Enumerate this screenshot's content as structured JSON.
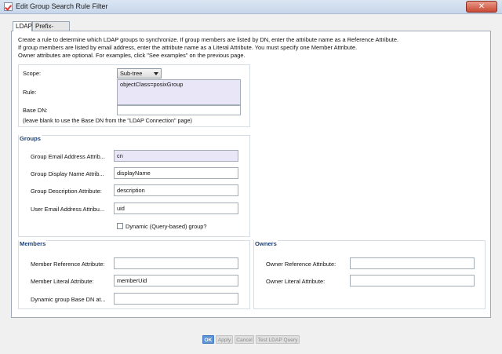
{
  "window": {
    "title": "Edit Group Search Rule Filter",
    "close_glyph": "✕"
  },
  "tabs": [
    {
      "label": "LDAP",
      "active": true
    },
    {
      "label": "Prefix-Suffix",
      "active": false
    }
  ],
  "intro": [
    "Create a rule to determine which LDAP groups to synchronize. If group members are listed by DN, enter the attribute name as a Reference Attribute.",
    "If group members are listed by email address, enter the attribute name as a Literal Attribute. You must specify one Member Attribute.",
    "Owner attributes are optional. For examples, click \"See examples\" on the previous page."
  ],
  "search": {
    "scope_label": "Scope:",
    "scope_value": "Sub-tree",
    "rule_label": "Rule:",
    "rule_value": "objectClass=posixGroup",
    "base_dn_label": "Base DN:",
    "base_dn_value": "",
    "base_dn_hint": "(leave blank to use the Base DN from the \"LDAP Connection\" page)"
  },
  "groups": {
    "title": "Groups",
    "email_label": "Group Email Address Attrib...",
    "email_value": "cn",
    "display_label": "Group Display Name Attrib...",
    "display_value": "displayName",
    "description_label": "Group Description Attribute:",
    "description_value": "description",
    "user_email_label": "User Email Address Attribu...",
    "user_email_value": "uid",
    "dynamic_label": "Dynamic (Query-based) group?",
    "dynamic_checked": false
  },
  "members": {
    "title": "Members",
    "reference_label": "Member Reference Attribute:",
    "reference_value": "",
    "literal_label": "Member Literal Attribute:",
    "literal_value": "memberUid",
    "dynamic_base_label": "Dynamic group Base DN at...",
    "dynamic_base_value": ""
  },
  "owners": {
    "title": "Owners",
    "reference_label": "Owner Reference Attribute:",
    "reference_value": "",
    "literal_label": "Owner Literal Attribute:",
    "literal_value": ""
  },
  "buttons": {
    "ok": "OK",
    "apply": "Apply",
    "cancel": "Cancel",
    "test": "Test LDAP Query"
  }
}
